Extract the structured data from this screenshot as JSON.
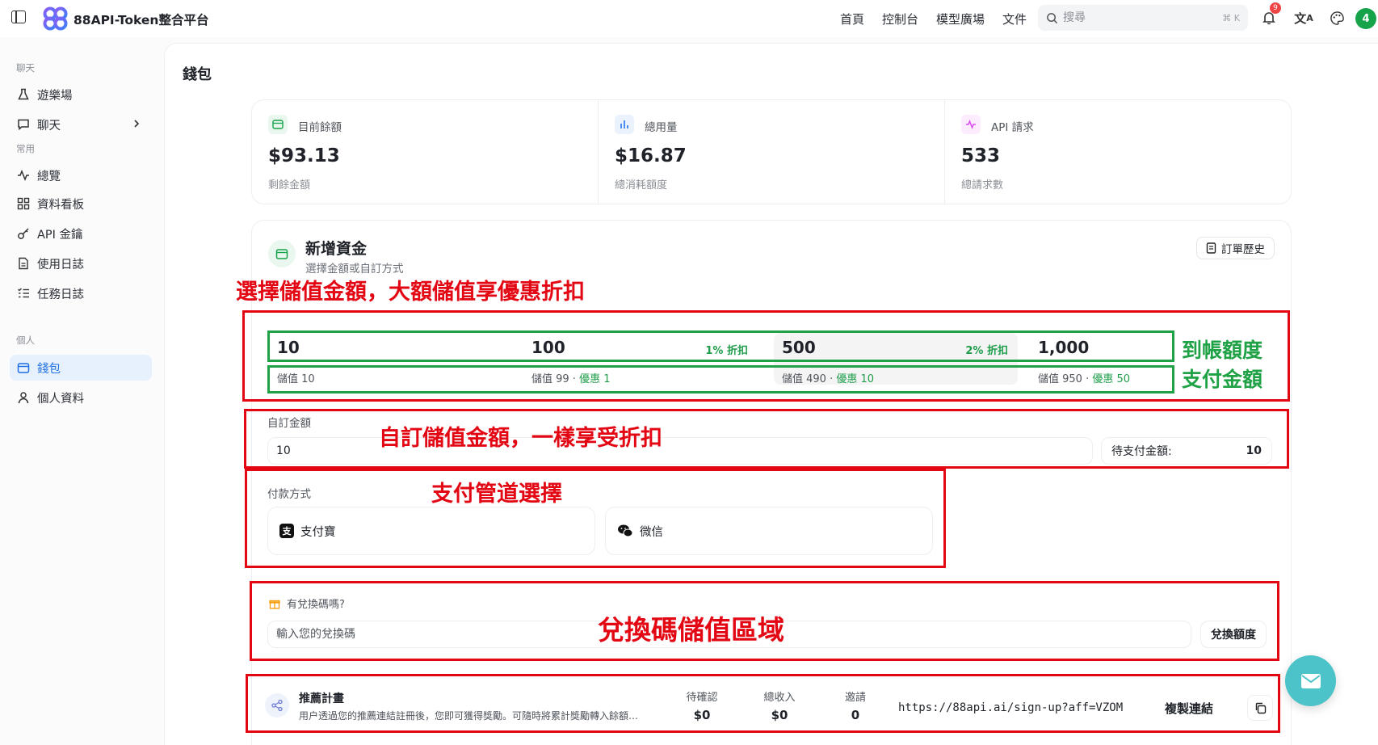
{
  "header": {
    "brand": "88API-Token整合平台",
    "nav": [
      "首頁",
      "控制台",
      "模型廣場",
      "文件"
    ],
    "search_placeholder": "搜尋",
    "search_shortcut": "⌘ K",
    "notification_count": "9",
    "avatar_letter": "4"
  },
  "sidebar": {
    "groups": {
      "chat": "聊天",
      "common": "常用",
      "personal": "個人"
    },
    "items": [
      {
        "label": "遊樂場",
        "icon": "flask-icon"
      },
      {
        "label": "聊天",
        "icon": "chat-icon"
      },
      {
        "label": "總覽",
        "icon": "activity-icon"
      },
      {
        "label": "資料看板",
        "icon": "dashboard-icon"
      },
      {
        "label": "API 金鑰",
        "icon": "key-icon"
      },
      {
        "label": "使用日誌",
        "icon": "log-icon"
      },
      {
        "label": "任務日誌",
        "icon": "task-icon"
      },
      {
        "label": "錢包",
        "icon": "wallet-icon",
        "active": true
      },
      {
        "label": "個人資料",
        "icon": "user-icon"
      }
    ]
  },
  "page": {
    "title": "錢包",
    "stats": [
      {
        "label": "目前餘額",
        "value": "$93.13",
        "sub": "剩餘金額",
        "icon": "wallet-icon",
        "color": "#16a34a"
      },
      {
        "label": "總用量",
        "value": "$16.87",
        "sub": "總消耗額度",
        "icon": "bar-chart-icon",
        "color": "#3b82f6"
      },
      {
        "label": "API 請求",
        "value": "533",
        "sub": "總請求數",
        "icon": "pulse-icon",
        "color": "#d946ef"
      }
    ]
  },
  "topup": {
    "title": "新增資金",
    "subtitle": "選擇金額或自訂方式",
    "order_history": "訂單歷史",
    "amounts": [
      {
        "value": "10",
        "discount": "",
        "pay_label": "儲值 10",
        "bonus": ""
      },
      {
        "value": "100",
        "discount": "1% 折扣",
        "pay_label": "儲值 99 · ",
        "bonus": "優惠 1"
      },
      {
        "value": "500",
        "discount": "2% 折扣",
        "pay_label": "儲值 490 · ",
        "bonus": "優惠 10"
      },
      {
        "value": "1,000",
        "discount": "",
        "pay_label": "儲值 950 · ",
        "bonus": "優惠 50"
      }
    ],
    "custom_label": "自訂金額",
    "custom_value": "10",
    "pending_label": "待支付金額:",
    "pending_value": "10",
    "payment_label": "付款方式",
    "payment_methods": [
      "支付寶",
      "微信"
    ],
    "redeem_title": "有兌換碼嗎?",
    "redeem_placeholder": "輸入您的兌換碼",
    "redeem_button": "兌換額度"
  },
  "referral": {
    "title": "推薦計畫",
    "desc": "用户透過您的推薦連結註冊後，您即可獲得獎勵。可隨時將累計獎勵轉入餘額…",
    "stats": [
      {
        "label": "待確認",
        "value": "$0"
      },
      {
        "label": "總收入",
        "value": "$0"
      },
      {
        "label": "邀請",
        "value": "0"
      }
    ],
    "link": "https://88api.ai/sign-up?aff=VZOM",
    "copy_label": "複製連結"
  },
  "annotations": {
    "amount_select": "選擇儲值金額，大額儲值享優惠折扣",
    "credited": "到帳額度",
    "paid": "支付金額",
    "custom": "自訂儲值金額，一樣享受折扣",
    "channel": "支付管道選擇",
    "redeem": "兌換碼儲值區域"
  },
  "colors": {
    "accent": "#1d6fe3",
    "annotation_red": "#e30613",
    "annotation_green": "#1fa245",
    "discount_green": "#1f9d4a"
  }
}
